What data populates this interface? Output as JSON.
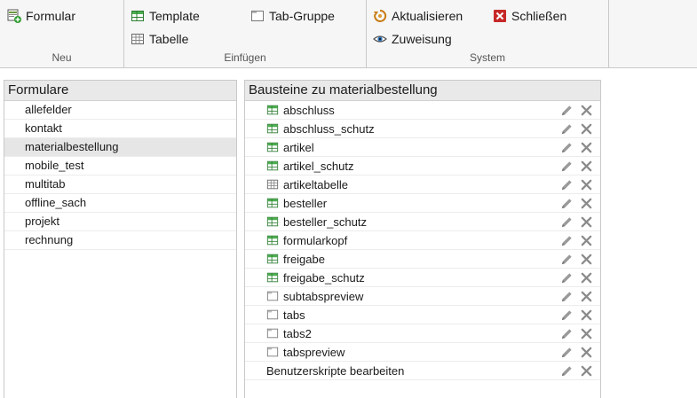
{
  "ribbon": {
    "groups": [
      {
        "caption": "Neu",
        "buttons": [
          {
            "label": "Formular"
          }
        ]
      },
      {
        "caption": "Einfügen",
        "buttons": [
          {
            "label": "Template"
          },
          {
            "label": "Tabelle"
          },
          {
            "label": "Tab-Gruppe"
          }
        ]
      },
      {
        "caption": "System",
        "buttons": [
          {
            "label": "Aktualisieren"
          },
          {
            "label": "Zuweisung"
          },
          {
            "label": "Schließen"
          }
        ]
      }
    ]
  },
  "left_panel": {
    "title": "Formulare",
    "items": [
      "allefelder",
      "kontakt",
      "materialbestellung",
      "mobile_test",
      "multitab",
      "offline_sach",
      "projekt",
      "rechnung"
    ],
    "selected": "materialbestellung"
  },
  "right_panel": {
    "title": "Bausteine zu materialbestellung",
    "items": [
      {
        "label": "abschluss",
        "icon": "template-icon"
      },
      {
        "label": "abschluss_schutz",
        "icon": "template-icon"
      },
      {
        "label": "artikel",
        "icon": "template-icon"
      },
      {
        "label": "artikel_schutz",
        "icon": "template-icon"
      },
      {
        "label": "artikeltabelle",
        "icon": "table-icon"
      },
      {
        "label": "besteller",
        "icon": "template-icon"
      },
      {
        "label": "besteller_schutz",
        "icon": "template-icon"
      },
      {
        "label": "formularkopf",
        "icon": "template-icon"
      },
      {
        "label": "freigabe",
        "icon": "template-icon"
      },
      {
        "label": "freigabe_schutz",
        "icon": "template-icon"
      },
      {
        "label": "subtabspreview",
        "icon": "tab-group-icon"
      },
      {
        "label": "tabs",
        "icon": "tab-group-icon"
      },
      {
        "label": "tabs2",
        "icon": "tab-group-icon"
      },
      {
        "label": "tabspreview",
        "icon": "tab-group-icon"
      }
    ],
    "script_label": "Benutzerskripte bearbeiten"
  },
  "colors": {
    "template_green": "#2e7d32",
    "delete_red": "#c62828",
    "selected_bg": "#e6e6e6",
    "panel_head": "#e9e9e9",
    "ribbon_bg": "#f6f6f6"
  }
}
